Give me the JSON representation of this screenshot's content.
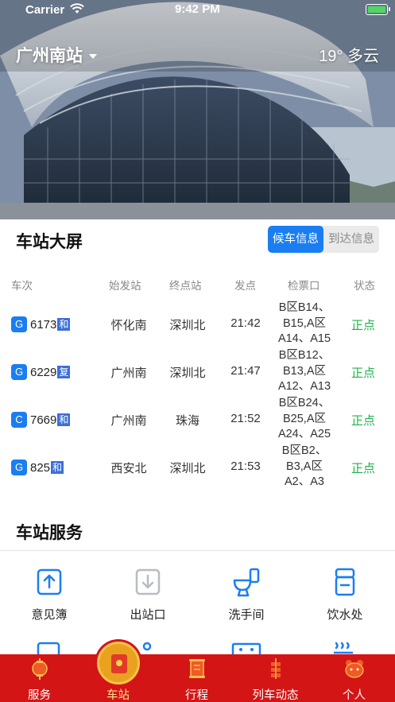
{
  "status_bar": {
    "carrier": "Carrier",
    "time": "9:42 PM"
  },
  "header": {
    "station": "广州南站",
    "weather": "19° 多云"
  },
  "big_screen": {
    "title": "车站大屏",
    "tabs": [
      {
        "label": "候车信息",
        "active": true
      },
      {
        "label": "到达信息",
        "active": false
      }
    ],
    "columns": [
      "车次",
      "始发站",
      "终点站",
      "发点",
      "检票口",
      "状态"
    ],
    "rows": [
      {
        "type": "G",
        "number": "6173",
        "tag": "和",
        "origin": "怀化南",
        "dest": "深圳北",
        "time": "21:42",
        "gate": [
          "B区B14、",
          "B15,A区",
          "A14、A15"
        ],
        "status": "正点"
      },
      {
        "type": "G",
        "number": "6229",
        "tag": "复",
        "origin": "广州南",
        "dest": "深圳北",
        "time": "21:47",
        "gate": [
          "B区B12、",
          "B13,A区",
          "A12、A13"
        ],
        "status": "正点"
      },
      {
        "type": "C",
        "number": "7669",
        "tag": "和",
        "origin": "广州南",
        "dest": "珠海",
        "time": "21:52",
        "gate": [
          "B区B24、",
          "B25,A区",
          "A24、A25"
        ],
        "status": "正点"
      },
      {
        "type": "G",
        "number": "825",
        "tag": "和",
        "origin": "西安北",
        "dest": "深圳北",
        "time": "21:53",
        "gate": [
          "B区B2、",
          "B3,A区",
          "A2、A3"
        ],
        "status": "正点"
      }
    ]
  },
  "services": {
    "title": "车站服务",
    "items": [
      {
        "label": "意见簿",
        "icon": "feedback-icon"
      },
      {
        "label": "出站口",
        "icon": "exit-icon"
      },
      {
        "label": "洗手间",
        "icon": "toilet-icon"
      },
      {
        "label": "饮水处",
        "icon": "water-icon"
      }
    ]
  },
  "tabbar": {
    "accent": "#d31516",
    "items": [
      {
        "label": "服务",
        "icon": "lantern-icon"
      },
      {
        "label": "车站",
        "icon": "red-envelope-icon",
        "active": true
      },
      {
        "label": "行程",
        "icon": "scroll-icon"
      },
      {
        "label": "列车动态",
        "icon": "firecracker-icon"
      },
      {
        "label": "个人",
        "icon": "mascot-icon"
      }
    ]
  }
}
